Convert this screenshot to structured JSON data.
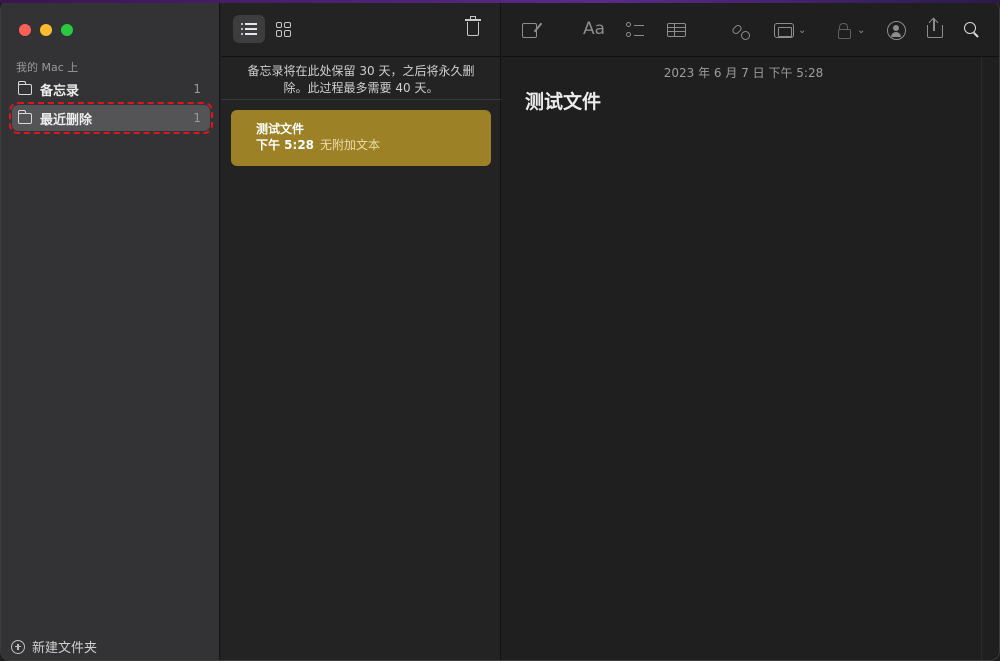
{
  "sidebar": {
    "section_label": "我的 Mac 上",
    "folders": [
      {
        "label": "备忘录",
        "count": "1",
        "selected": false
      },
      {
        "label": "最近删除",
        "count": "1",
        "selected": true
      }
    ],
    "new_folder_label": "新建文件夹"
  },
  "list_pane": {
    "notice": "备忘录将在此处保留 30 天，之后将永久删除。此过程最多需要 40 天。",
    "notes": [
      {
        "title": "测试文件",
        "time": "下午 5:28",
        "preview": "无附加文本"
      }
    ]
  },
  "editor": {
    "date": "2023 年 6 月 7 日 下午 5:28",
    "heading": "测试文件",
    "format_label": "Aa"
  },
  "colors": {
    "selected_note": "#9d8126",
    "highlight_outline": "#e0141e"
  },
  "icons": [
    "list-view-icon",
    "gallery-view-icon",
    "trash-icon",
    "compose-icon",
    "format-icon",
    "checklist-icon",
    "table-icon",
    "link-icon",
    "media-icon",
    "lock-icon",
    "collaborate-icon",
    "share-icon",
    "search-icon",
    "folder-icon",
    "plus-circle-icon"
  ]
}
